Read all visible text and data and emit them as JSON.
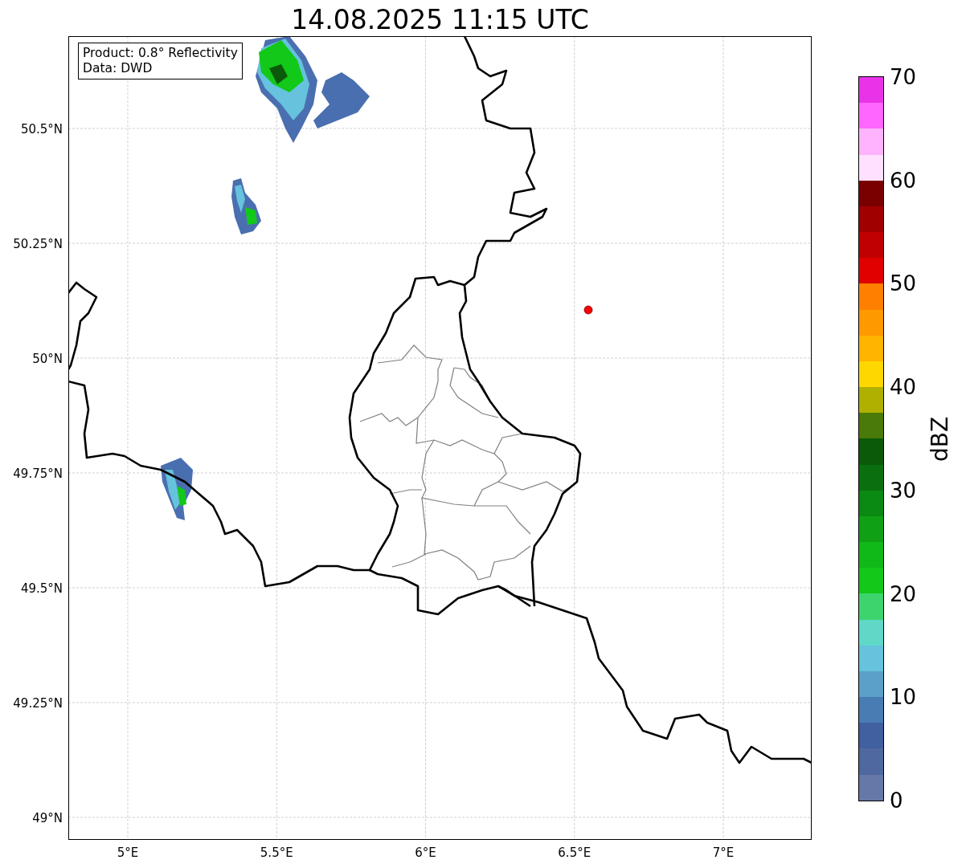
{
  "title": "14.08.2025 11:15 UTC",
  "info_box": {
    "lines": [
      "Product: 0.8° Reflectivity",
      "Data: DWD"
    ]
  },
  "map": {
    "y_ticks": [
      "50.5°N",
      "50.25°N",
      "50°N",
      "49.75°N",
      "49.5°N",
      "49.25°N",
      "49°N"
    ],
    "x_ticks": [
      "5°E",
      "5.5°E",
      "6°E",
      "6.5°E",
      "7°E"
    ]
  },
  "colorbar": {
    "label": "dBZ",
    "ticks": [
      "70",
      "60",
      "50",
      "40",
      "30",
      "20",
      "10",
      "0"
    ],
    "bins": [
      {
        "color": "#e933e9"
      },
      {
        "color": "#ff66ff"
      },
      {
        "color": "#ffb3ff"
      },
      {
        "color": "#ffe0ff"
      },
      {
        "color": "#7a0000"
      },
      {
        "color": "#a00000"
      },
      {
        "color": "#c00000"
      },
      {
        "color": "#e00000"
      },
      {
        "color": "#ff8000"
      },
      {
        "color": "#ff9900"
      },
      {
        "color": "#ffb400"
      },
      {
        "color": "#ffd700"
      },
      {
        "color": "#b0b000"
      },
      {
        "color": "#4a7a0a"
      },
      {
        "color": "#0a5a0a"
      },
      {
        "color": "#0a700f"
      },
      {
        "color": "#0a8a12"
      },
      {
        "color": "#10a015"
      },
      {
        "color": "#10b818"
      },
      {
        "color": "#12c818"
      },
      {
        "color": "#3dd46e"
      },
      {
        "color": "#60d8c8"
      },
      {
        "color": "#66c2dd"
      },
      {
        "color": "#5aa0c8"
      },
      {
        "color": "#4a7cb4"
      },
      {
        "color": "#4060a0"
      },
      {
        "color": "#5068a0"
      },
      {
        "color": "#6678a8"
      }
    ]
  }
}
